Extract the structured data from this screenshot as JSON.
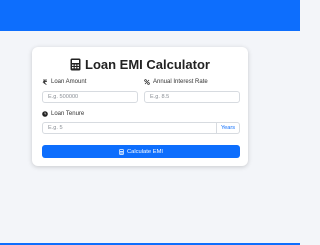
{
  "calculator": {
    "title": "Loan EMI Calculator",
    "fields": {
      "amount": {
        "label": "Loan Amount",
        "placeholder": "E.g. 500000",
        "icon": "rupee-icon"
      },
      "rate": {
        "label": "Annual Interest Rate",
        "placeholder": "E.g. 8.5",
        "icon": "percent-icon"
      },
      "tenure": {
        "label": "Loan Tenure",
        "placeholder": "E.g. 5",
        "unit": "Years",
        "icon": "clock-icon"
      }
    },
    "button_label": "Calculate EMI",
    "accent_color": "#0d6efd"
  }
}
